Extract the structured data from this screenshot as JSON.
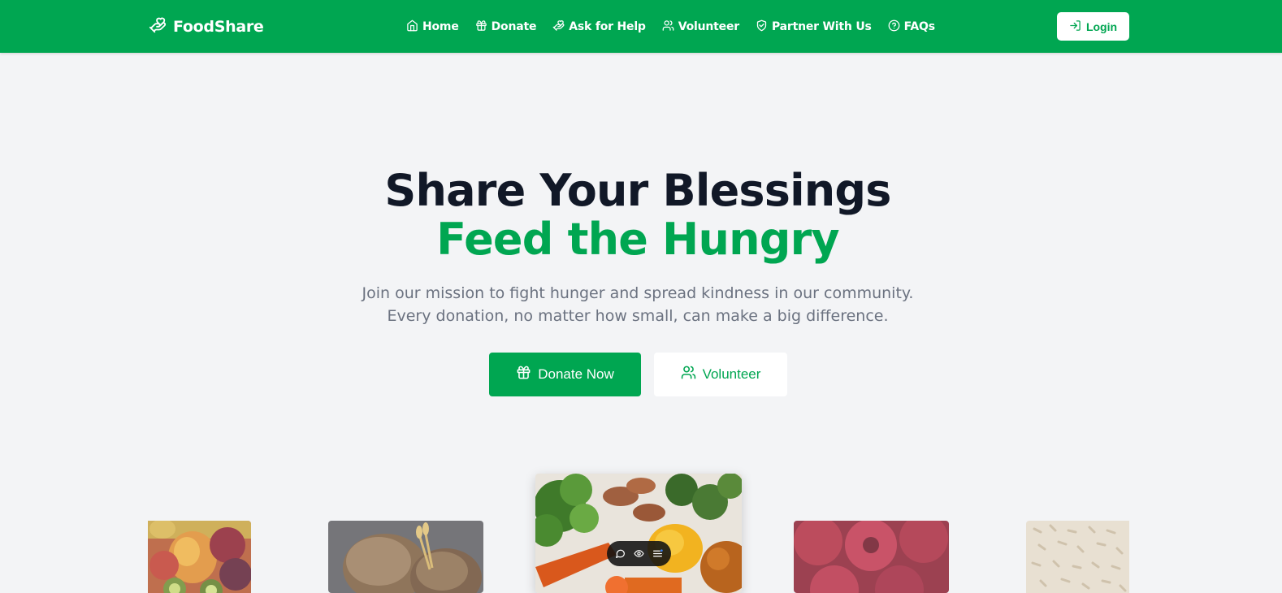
{
  "brand": {
    "name": "FoodShare",
    "icon": "hand-heart-icon"
  },
  "nav": {
    "items": [
      {
        "label": "Home",
        "icon": "home-icon"
      },
      {
        "label": "Donate",
        "icon": "gift-icon"
      },
      {
        "label": "Ask for Help",
        "icon": "hand-heart-icon"
      },
      {
        "label": "Volunteer",
        "icon": "users-icon"
      },
      {
        "label": "Partner With Us",
        "icon": "handshake-icon"
      },
      {
        "label": "FAQs",
        "icon": "help-circle-icon"
      }
    ],
    "login_label": "Login"
  },
  "hero": {
    "title_line1": "Share Your Blessings",
    "title_line2": "Feed the Hungry",
    "subtitle_line1": "Join our mission to fight hunger and spread kindness in our community.",
    "subtitle_line2": "Every donation, no matter how small, can make a big difference.",
    "primary_button": "Donate Now",
    "secondary_button": "Volunteer"
  },
  "gallery": {
    "images": [
      "fruits",
      "bread",
      "vegetables",
      "raspberries",
      "rice"
    ],
    "toolbar_icons": [
      "comment-icon",
      "eye-icon",
      "menu-icon"
    ]
  },
  "colors": {
    "primary": "#00a651",
    "heading": "#111827",
    "muted": "#6b7280",
    "background": "#f3f4f6"
  }
}
